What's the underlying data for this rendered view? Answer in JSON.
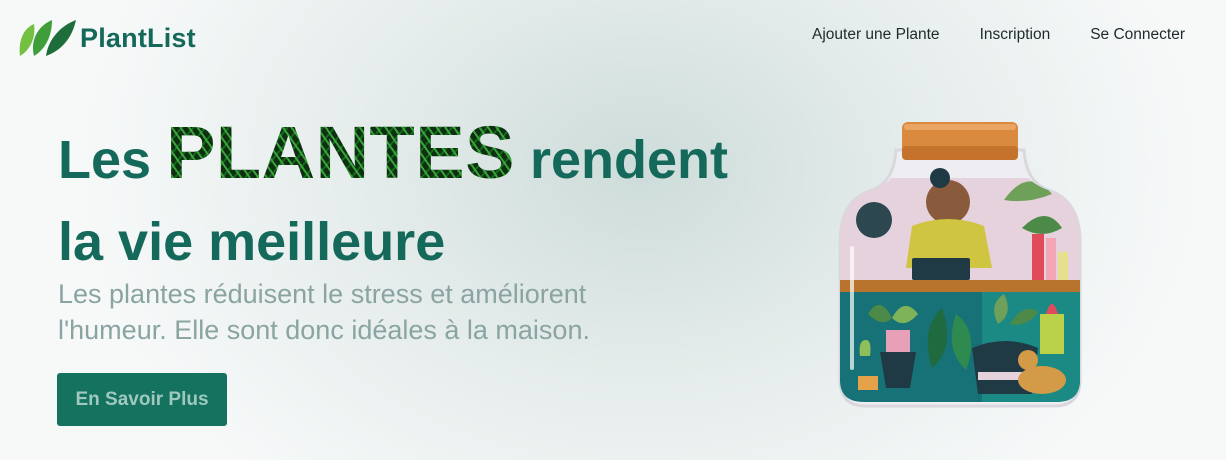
{
  "nav": {
    "brand": "PlantList",
    "links": [
      "Ajouter une Plante",
      "Inscription",
      "Se Connecter"
    ]
  },
  "hero": {
    "title_start": "Les",
    "title_highlight": "PLANTES",
    "title_end": "rendent la vie meilleure",
    "subtitle": "Les plantes réduisent le stress et améliorent l'humeur. Elle sont donc idéales à la maison.",
    "cta_label": "En Savoir Plus"
  },
  "colors": {
    "brand": "#14695a",
    "cta": "#14725f",
    "subtitle": "#8aa4a2"
  },
  "icons": {
    "logo": "leaves-logo-icon",
    "illustration": "plant-terrarium-jar-illustration"
  }
}
